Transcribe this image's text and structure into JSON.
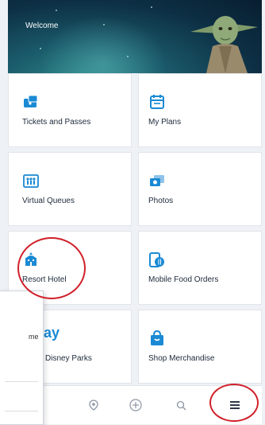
{
  "header": {
    "welcome": "Welcome"
  },
  "tiles": [
    {
      "label": "Tickets and Passes",
      "icon": "ticket-icon"
    },
    {
      "label": "My Plans",
      "icon": "calendar-icon"
    },
    {
      "label": "Virtual Queues",
      "icon": "queue-icon"
    },
    {
      "label": "Photos",
      "icon": "photos-icon"
    },
    {
      "label": "Resort Hotel",
      "icon": "hotel-icon"
    },
    {
      "label": "Mobile Food Orders",
      "icon": "food-order-icon"
    },
    {
      "label": "Disney Parks",
      "prefix": "ay",
      "icon": "parks-icon"
    },
    {
      "label": "Shop Merchandise",
      "icon": "shopping-bag-icon"
    }
  ],
  "popup": {
    "partial_text": "me"
  },
  "nav": {
    "items": [
      "location-icon",
      "add-icon",
      "search-icon",
      "menu-icon"
    ]
  },
  "colors": {
    "accent": "#1a8ad4",
    "highlight_ring": "#d0202a"
  }
}
